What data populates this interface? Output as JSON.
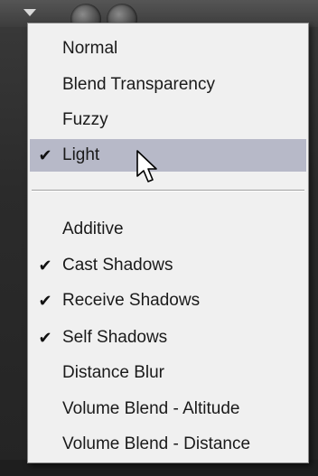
{
  "menu": {
    "group_1": [
      {
        "label": "Normal",
        "checked": false
      },
      {
        "label": "Blend Transparency",
        "checked": false
      },
      {
        "label": "Fuzzy",
        "checked": false
      },
      {
        "label": "Light",
        "checked": true,
        "highlighted": true
      }
    ],
    "group_2": [
      {
        "label": "Additive",
        "checked": false
      },
      {
        "label": "Cast Shadows",
        "checked": true
      },
      {
        "label": "Receive Shadows",
        "checked": true
      },
      {
        "label": "Self Shadows",
        "checked": true
      },
      {
        "label": "Distance Blur",
        "checked": false
      },
      {
        "label": "Volume Blend - Altitude",
        "checked": false
      },
      {
        "label": "Volume Blend - Distance",
        "checked": false
      }
    ],
    "check_glyph": "✔"
  },
  "colors": {
    "menu_background": "#f0f0f0",
    "highlight": "#b7b9c8",
    "text": "#1a1a1a"
  },
  "icons": {
    "cursor": "mouse-pointer-icon",
    "checkmark": "checkmark-icon"
  }
}
